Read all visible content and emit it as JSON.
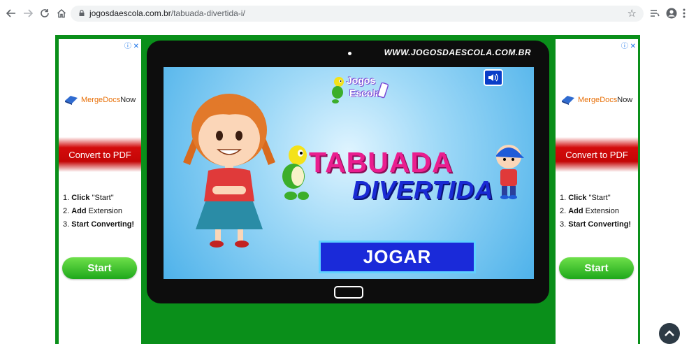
{
  "browser": {
    "url_domain": "jogosdaescola.com.br",
    "url_path": "/tabuada-divertida-i/"
  },
  "ads": {
    "left": {
      "brand_part1": "Merge",
      "brand_part2": "Docs",
      "brand_part3": "Now",
      "banner": "Convert to PDF",
      "step1_prefix": "1. ",
      "step1_bold": "Click",
      "step1_rest": " \"Start\"",
      "step2_prefix": "2. ",
      "step2_bold": "Add",
      "step2_rest": " Extension",
      "step3_prefix": "3. ",
      "step3_bold": "Start Converting!",
      "button": "Start"
    },
    "right": {
      "brand_part1": "Merge",
      "brand_part2": "Docs",
      "brand_part3": "Now",
      "banner": "Convert to PDF",
      "step1_prefix": "1. ",
      "step1_bold": "Click",
      "step1_rest": " \"Start\"",
      "step2_prefix": "2. ",
      "step2_bold": "Add",
      "step2_rest": " Extension",
      "step3_prefix": "3. ",
      "step3_bold": "Start Converting!",
      "button": "Start"
    }
  },
  "game": {
    "site_url": "WWW.JOGOSDAESCOLA.COM.BR",
    "logo_line1": "Jogos",
    "logo_line2": "Escola",
    "title_line1": "TABUADA",
    "title_line2": "DIVERTIDA",
    "play_button": "JOGAR"
  },
  "colors": {
    "page_green": "#0a8f1a",
    "title_pink": "#ea1e8f",
    "title_blue": "#1a2ad4",
    "play_blue": "#1a2ad9"
  }
}
